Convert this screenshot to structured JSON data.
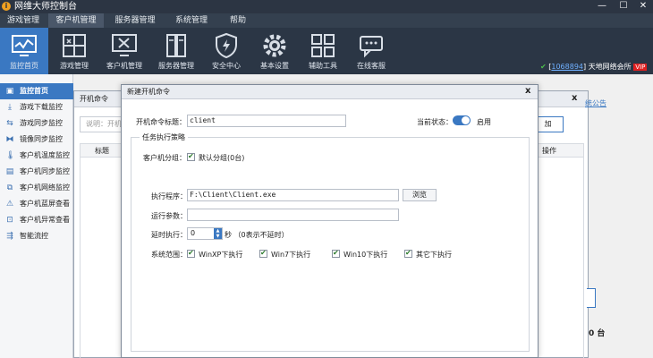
{
  "window": {
    "title": "网维大师控制台",
    "logo_char": "i"
  },
  "menu": [
    "游戏管理",
    "客户机管理",
    "服务器管理",
    "系统管理",
    "帮助"
  ],
  "toolbar": [
    {
      "label": "监控首页",
      "icon": "monitor-chart-icon",
      "active": true
    },
    {
      "label": "游戏管理",
      "icon": "game-grid-icon",
      "active": false
    },
    {
      "label": "客户机管理",
      "icon": "client-tools-icon",
      "active": false
    },
    {
      "label": "服务器管理",
      "icon": "server-icon",
      "active": false
    },
    {
      "label": "安全中心",
      "icon": "shield-bolt-icon",
      "active": false
    },
    {
      "label": "基本设置",
      "icon": "gear-icon",
      "active": false
    },
    {
      "label": "辅助工具",
      "icon": "apps-grid-icon",
      "active": false
    },
    {
      "label": "在线客服",
      "icon": "chat-icon",
      "active": false
    }
  ],
  "status": {
    "check": "✔",
    "bracket_open": "[",
    "account": "1068894",
    "bracket_close": "]",
    "net_name": "天地网络会所",
    "vip": "VIP"
  },
  "sidebar": [
    {
      "label": "监控首页",
      "icon": "▣",
      "active": true
    },
    {
      "label": "游戏下载监控",
      "icon": "⤓",
      "active": false
    },
    {
      "label": "游戏同步监控",
      "icon": "⇆",
      "active": false
    },
    {
      "label": "镜像同步监控",
      "icon": "⧓",
      "active": false
    },
    {
      "label": "客户机温度监控",
      "icon": "🌡",
      "active": false
    },
    {
      "label": "客户机同步监控",
      "icon": "▤",
      "active": false
    },
    {
      "label": "客户机网络监控",
      "icon": "⧉",
      "active": false
    },
    {
      "label": "客户机蓝屏查看",
      "icon": "⚠",
      "active": false
    },
    {
      "label": "客户机异常查看",
      "icon": "⊡",
      "active": false
    },
    {
      "label": "智能流控",
      "icon": "⇶",
      "active": false
    }
  ],
  "bg_window": {
    "title": "开机命令",
    "close": "x",
    "search_placeholder": "说明：开机",
    "add_button": "加",
    "col_title": "标题",
    "col_action": "操作"
  },
  "notice_link": "统公告",
  "client_count": "0 台",
  "dialog": {
    "title": "新建开机命令",
    "close": "x",
    "cmd_title_label": "开机命令标题：",
    "cmd_title_value": "client",
    "state_label": "当前状态：",
    "state_enabled": "启用",
    "group_title": "任务执行策略",
    "client_group_label": "客户机分组：",
    "client_group_value": "默认分组(0台)",
    "exec_label": "执行程序：",
    "exec_value": "F:\\Client\\Client.exe",
    "browse_button": "浏览",
    "args_label": "运行参数：",
    "args_value": "",
    "delay_label": "延时执行：",
    "delay_value": "0",
    "delay_unit": "秒  （0表示不延时）",
    "scope_label": "系统范围：",
    "scopes": [
      "WinXP下执行",
      "Win7下执行",
      "Win10下执行",
      "其它下执行"
    ]
  }
}
